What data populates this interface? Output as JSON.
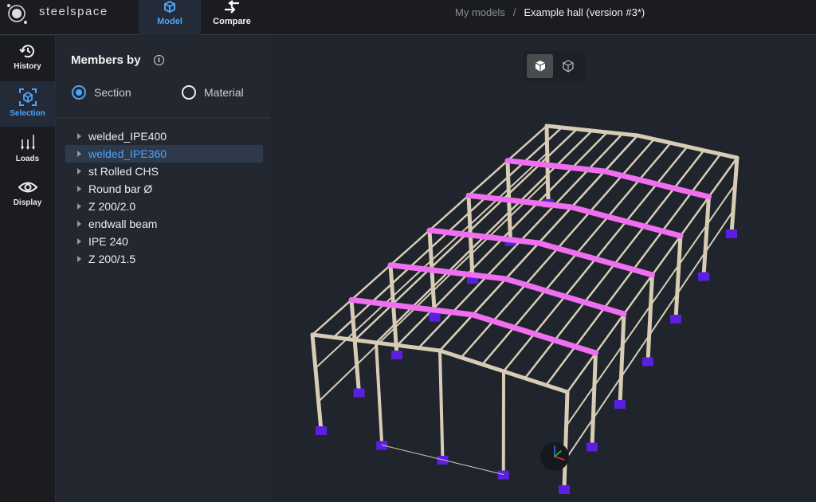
{
  "header": {
    "brand": "steelspace",
    "tabs": [
      {
        "label": "Model",
        "active": true
      },
      {
        "label": "Compare",
        "active": false
      }
    ],
    "breadcrumb": {
      "root": "My models",
      "separator": "/",
      "current": "Example hall (version #3*)"
    }
  },
  "nav": [
    {
      "label": "History",
      "icon": "history-icon"
    },
    {
      "label": "Selection",
      "icon": "selection-cube-icon",
      "active": true
    },
    {
      "label": "Loads",
      "icon": "loads-arrows-icon"
    },
    {
      "label": "Display",
      "icon": "eye-icon"
    }
  ],
  "panel": {
    "title": "Members by",
    "group_options": [
      {
        "label": "Section",
        "selected": true
      },
      {
        "label": "Material",
        "selected": false
      }
    ],
    "sections": [
      "welded_IPE400",
      "welded_IPE360",
      "st Rolled CHS",
      "Round bar Ø",
      "Z 200/2.0",
      "endwall beam",
      "IPE 240",
      "Z 200/1.5"
    ],
    "selected_index": 1
  },
  "viewport": {
    "view_modes": [
      "solid",
      "wireframe"
    ],
    "active_view_mode": "solid",
    "colors": {
      "member": "#d8cdb4",
      "highlight": "#f06ef0",
      "support": "#5a1fe0",
      "background": "#1f242d"
    }
  }
}
